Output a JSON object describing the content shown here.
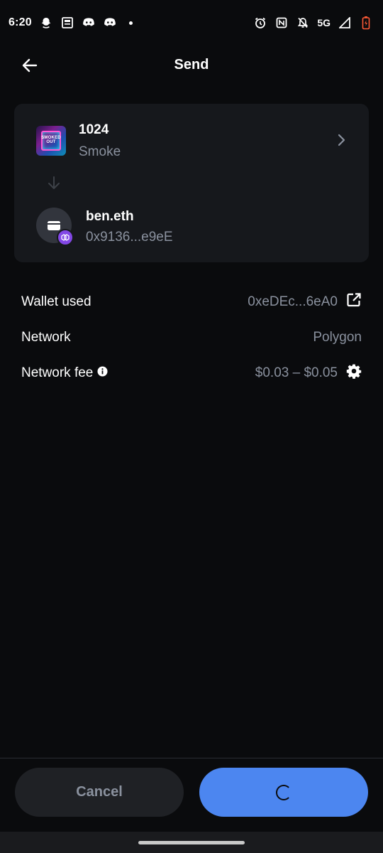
{
  "status_bar": {
    "time": "6:20",
    "network": "5G",
    "left_icons": [
      "snapchat-icon",
      "news-icon",
      "discord-icon",
      "discord-icon",
      "dot-icon"
    ],
    "right_icons": [
      "alarm-icon",
      "nfc-icon",
      "silent-icon",
      "signal-icon",
      "battery-icon"
    ]
  },
  "header": {
    "title": "Send",
    "back_icon": "arrow-left-icon"
  },
  "transfer": {
    "nft": {
      "title": "1024",
      "subtitle": "Smoke",
      "thumb_text": "SMOKED OUT"
    },
    "recipient": {
      "name": "ben.eth",
      "address": "0x9136...e9eE"
    }
  },
  "details": {
    "wallet": {
      "label": "Wallet used",
      "value": "0xeDEc...6eA0"
    },
    "network": {
      "label": "Network",
      "value": "Polygon"
    },
    "fee": {
      "label": "Network fee",
      "value": "$0.03 – $0.05"
    }
  },
  "actions": {
    "cancel_label": "Cancel",
    "confirm_state": "loading"
  },
  "colors": {
    "background": "#0a0b0d",
    "card": "#16181c",
    "secondary_text": "#8a919e",
    "primary_button": "#4c86f0",
    "polygon": "#8247e5"
  }
}
